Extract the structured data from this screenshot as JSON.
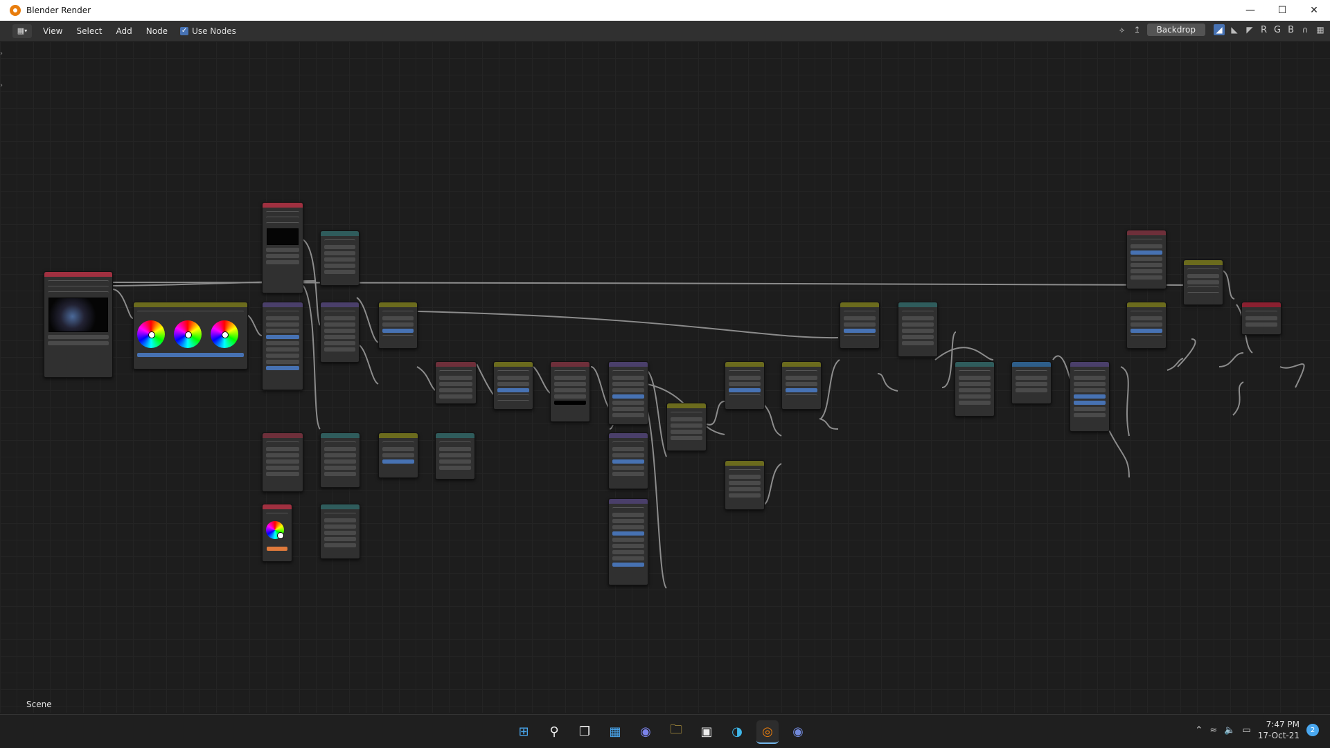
{
  "window": {
    "title": "Blender Render",
    "minimize": "—",
    "maximize": "☐",
    "close": "✕"
  },
  "header": {
    "menus": [
      "View",
      "Select",
      "Add",
      "Node"
    ],
    "use_nodes_label": "Use Nodes",
    "backdrop_label": "Backdrop",
    "channels": [
      "R",
      "G",
      "B"
    ]
  },
  "footer": {
    "scene_label": "Scene"
  },
  "taskbar": {
    "time": "7:47 PM",
    "date": "17-Oct-21",
    "notification_count": "2"
  },
  "colors": {
    "accent": "#4772b3",
    "link": "#a0a0a0",
    "socket": "#c7c729"
  }
}
